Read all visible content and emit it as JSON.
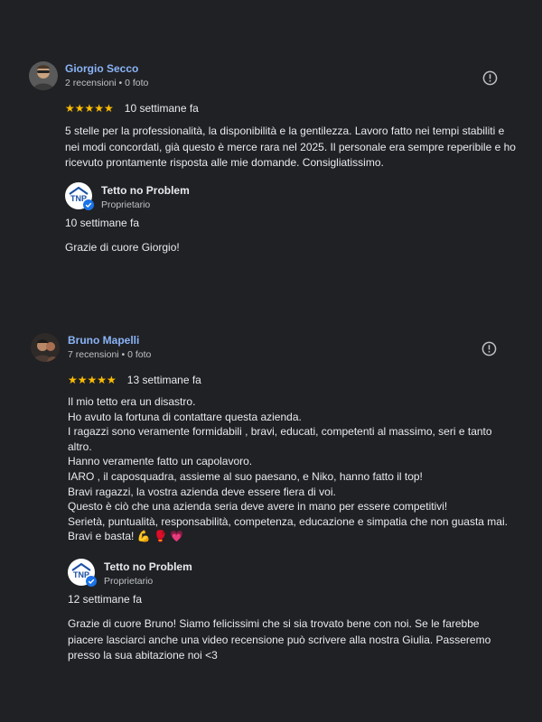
{
  "reviews": [
    {
      "reviewer": {
        "name": "Giorgio Secco",
        "meta": "2 recensioni • 0 foto",
        "avatar_icon": "person-photo-avatar"
      },
      "rating": 5,
      "stars": "★★★★★",
      "date": "10 settimane fa",
      "text": [
        "5 stelle per la professionalità, la disponibilità e la gentilezza. Lavoro fatto nei tempi stabiliti e nei modi concordati, già questo è merce rara nel 2025. Il personale era sempre reperibile e ho ricevuto prontamente risposta alle mie domande. Consigliatissimo."
      ],
      "owner_reply": {
        "name": "Tetto no Problem",
        "role": "Proprietario",
        "logo_text": "TNP",
        "date": "10 settimane fa",
        "text": "Grazie di cuore Giorgio!"
      }
    },
    {
      "reviewer": {
        "name": "Bruno Mapelli",
        "meta": "7 recensioni • 0 foto",
        "avatar_icon": "person-photo-avatar"
      },
      "rating": 5,
      "stars": "★★★★★",
      "date": "13 settimane fa",
      "text": [
        "Il mio tetto era un disastro.",
        "Ho avuto la fortuna di contattare questa azienda.",
        "I ragazzi sono veramente formidabili , bravi, educati, competenti al massimo, seri e tanto altro.",
        "Hanno veramente fatto un capolavoro.",
        "IARO , il caposquadra, assieme al suo paesano, e Niko, hanno fatto il top!",
        "Bravi ragazzi, la vostra azienda deve essere fiera di voi.",
        "Questo è ciò che una azienda seria deve avere in mano per essere competitivi!",
        "Serietà, puntualità, responsabilità, competenza, educazione e simpatia che non guasta mai.",
        "Bravi e basta! 💪 🥊 💗"
      ],
      "owner_reply": {
        "name": "Tetto no Problem",
        "role": "Proprietario",
        "logo_text": "TNP",
        "date": "12 settimane fa",
        "text": "Grazie di cuore Bruno! Siamo felicissimi che si sia trovato bene con noi. Se le farebbe piacere lasciarci anche una video recensione può scrivere alla nostra Giulia. Passeremo presso la sua abitazione noi <3"
      }
    }
  ],
  "colors": {
    "background": "#202124",
    "text": "#e8eaed",
    "secondary_text": "#bdc1c6",
    "link": "#8ab4f8",
    "star": "#fbbc04",
    "verified": "#1a73e8"
  },
  "icons": {
    "more": "info-circle-icon",
    "verified": "verified-check-icon"
  }
}
